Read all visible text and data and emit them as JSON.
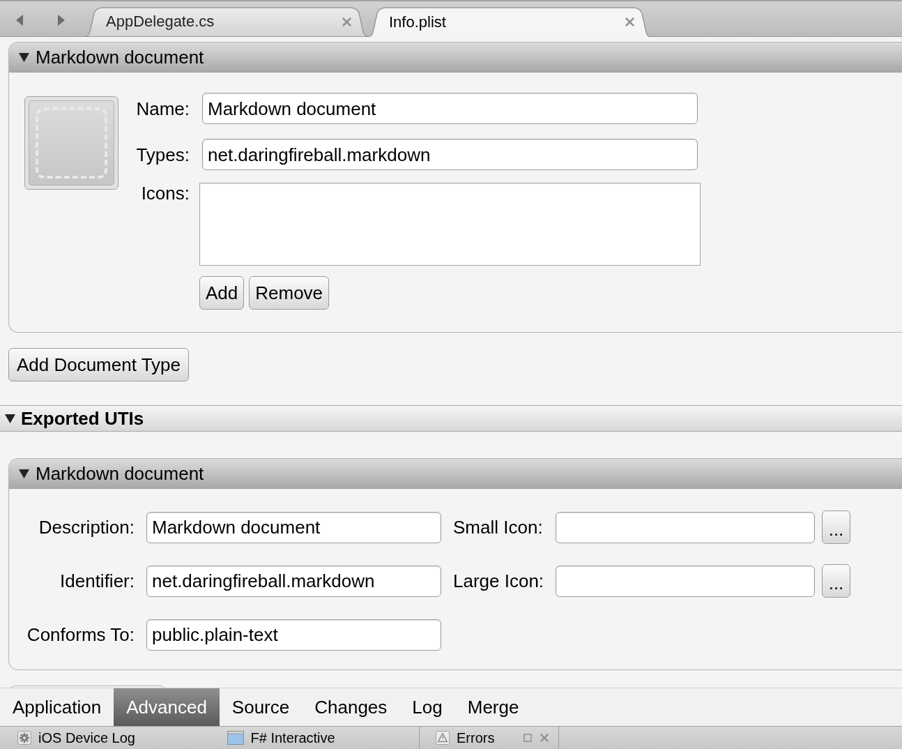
{
  "editor_tabs": [
    {
      "label": "AppDelegate.cs",
      "selected": false
    },
    {
      "label": "Info.plist",
      "selected": true
    }
  ],
  "document_types": {
    "items": [
      {
        "title": "Markdown document",
        "expanded": true,
        "fields": [
          {
            "label": "Name:",
            "value": "Markdown document"
          },
          {
            "label": "Types:",
            "value": "net.daringfireball.markdown"
          }
        ],
        "icons_label": "Icons:",
        "buttons": [
          "Add",
          "Remove"
        ]
      }
    ],
    "add_button": "Add Document Type"
  },
  "exported_utis": {
    "title": "Exported UTIs",
    "expanded": true,
    "items": [
      {
        "title": "Markdown document",
        "expanded": true,
        "rows": [
          [
            {
              "kind": "text",
              "label": "Description:",
              "value": "Markdown document"
            },
            {
              "kind": "file",
              "label": "Small Icon:",
              "button": "..."
            }
          ],
          [
            {
              "kind": "text",
              "label": "Identifier:",
              "value": "net.daringfireball.markdown"
            },
            {
              "kind": "file",
              "label": "Large Icon:",
              "button": "..."
            }
          ],
          [
            {
              "kind": "text",
              "label": "Conforms To:",
              "value": "public.plain-text"
            }
          ]
        ]
      }
    ]
  },
  "bottom_tabs": [
    {
      "label": "Application",
      "selected": false
    },
    {
      "label": "Advanced",
      "selected": true
    },
    {
      "label": "Source",
      "selected": false
    },
    {
      "label": "Changes",
      "selected": false
    },
    {
      "label": "Log",
      "selected": false
    },
    {
      "label": "Merge",
      "selected": false
    }
  ],
  "pad_groups": [
    {
      "pads": [
        {
          "kind": "log",
          "label": "iOS Device Log"
        },
        {
          "kind": "console",
          "label": "F# Interactive"
        }
      ]
    },
    {
      "pads": [
        {
          "kind": "errors",
          "label": "Errors"
        }
      ],
      "window_controls": true
    }
  ]
}
